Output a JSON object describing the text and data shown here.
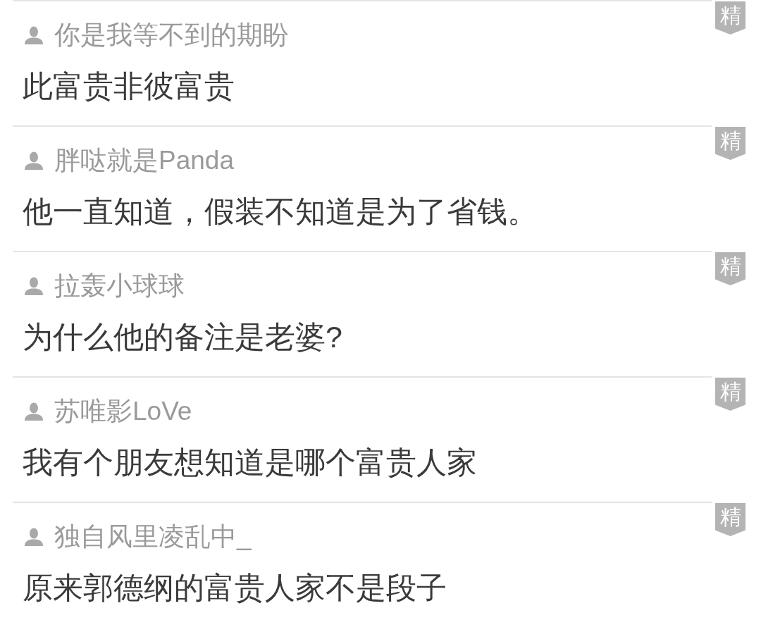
{
  "comments": [
    {
      "username": "你是我等不到的期盼",
      "text": "此富贵非彼富贵",
      "badge": "精"
    },
    {
      "username": "胖哒就是Panda",
      "text": "他一直知道，假装不知道是为了省钱。",
      "badge": "精"
    },
    {
      "username": "拉轰小球球",
      "text": "为什么他的备注是老婆?",
      "badge": "精"
    },
    {
      "username": "苏唯影LoVe",
      "text": "我有个朋友想知道是哪个富贵人家",
      "badge": "精"
    },
    {
      "username": "独自风里凌乱中_",
      "text": "原来郭德纲的富贵人家不是段子",
      "badge": "精"
    }
  ]
}
